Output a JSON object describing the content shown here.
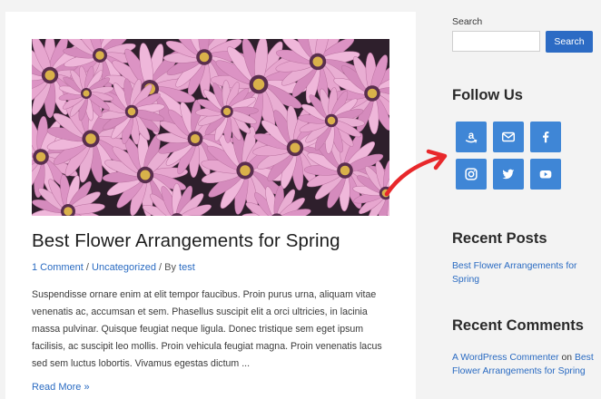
{
  "post": {
    "title": "Best Flower Arrangements for Spring",
    "meta": {
      "comments": "1 Comment",
      "sep1": " / ",
      "category": "Uncategorized",
      "sep2": " / By ",
      "author": "test"
    },
    "excerpt": "Suspendisse ornare enim at elit tempor faucibus. Proin purus urna, aliquam vitae venenatis ac, accumsan et sem. Phasellus suscipit elit a orci ultricies, in lacinia massa pulvinar. Quisque feugiat neque ligula. Donec tristique sem eget ipsum facilisis, ac suscipit leo mollis. Proin vehicula feugiat magna. Proin venenatis lacus sed sem luctus lobortis. Vivamus egestas dictum ...",
    "read_more": "Read More »"
  },
  "sidebar": {
    "search": {
      "label": "Search",
      "value": "",
      "placeholder": "",
      "button": "Search"
    },
    "follow_title": "Follow Us",
    "social_icons": [
      "amazon-icon",
      "email-icon",
      "facebook-icon",
      "instagram-icon",
      "twitter-icon",
      "youtube-icon"
    ],
    "recent_posts_title": "Recent Posts",
    "recent_posts": [
      "Best Flower Arrangements for Spring"
    ],
    "recent_comments_title": "Recent Comments",
    "recent_comment": {
      "author": "A WordPress Commenter",
      "on": " on ",
      "post": "Best Flower Arrangements for Spring"
    }
  },
  "colors": {
    "accent": "#2c6bc4",
    "social": "#3f86d6",
    "arrow": "#e8282b",
    "background": "#f3f3f3"
  }
}
